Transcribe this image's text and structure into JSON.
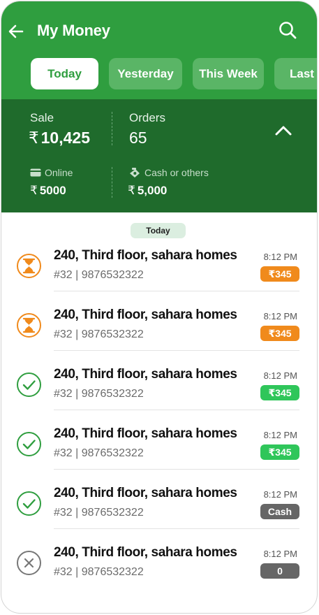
{
  "header": {
    "title": "My Money",
    "back_icon": "arrow-left-icon",
    "search_icon": "search-icon",
    "tabs": [
      {
        "label": "Today",
        "active": true
      },
      {
        "label": "Yesterday",
        "active": false
      },
      {
        "label": "This Week",
        "active": false
      },
      {
        "label": "Last W",
        "active": false
      }
    ]
  },
  "summary": {
    "sale_label": "Sale",
    "sale_currency": "₹",
    "sale_value": "10,425",
    "orders_label": "Orders",
    "orders_value": "65",
    "online_label": "Online",
    "online_currency": "₹",
    "online_value": "5000",
    "cash_label": "Cash or others",
    "cash_currency": "₹",
    "cash_value": "5,000",
    "collapse_icon": "chevron-up-icon"
  },
  "list": {
    "date_chip": "Today",
    "orders": [
      {
        "address": "240, Third floor, sahara homes",
        "meta": "#32 | 9876532322",
        "time": "8:12 PM",
        "badge": "₹345",
        "status": "pending"
      },
      {
        "address": "240, Third floor, sahara homes",
        "meta": "#32 | 9876532322",
        "time": "8:12 PM",
        "badge": "₹345",
        "status": "pending"
      },
      {
        "address": "240, Third floor, sahara homes",
        "meta": "#32 | 9876532322",
        "time": "8:12 PM",
        "badge": "₹345",
        "status": "done"
      },
      {
        "address": "240, Third floor, sahara homes",
        "meta": "#32 | 9876532322",
        "time": "8:12 PM",
        "badge": "₹345",
        "status": "done"
      },
      {
        "address": "240, Third floor, sahara homes",
        "meta": "#32 | 9876532322",
        "time": "8:12 PM",
        "badge": "Cash",
        "status": "done"
      },
      {
        "address": "240, Third floor, sahara homes",
        "meta": "#32 | 9876532322",
        "time": "8:12 PM",
        "badge": "0",
        "status": "cancelled"
      }
    ]
  },
  "colors": {
    "brand_green": "#2f9e3f",
    "summary_green": "#1f6b2c",
    "pending_orange": "#f08a1c",
    "paid_green": "#2fc65a",
    "neutral_grey": "#666666"
  }
}
